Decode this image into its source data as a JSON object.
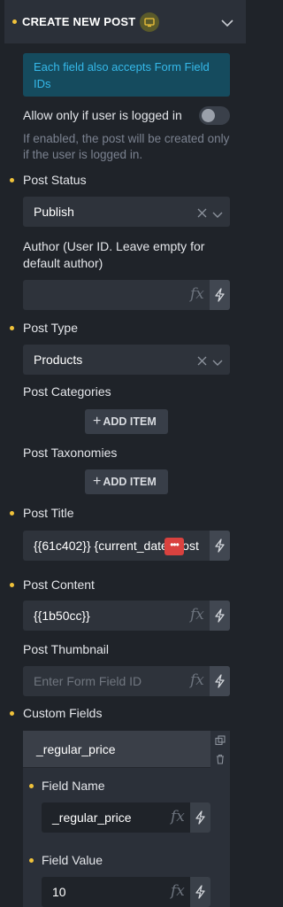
{
  "header": {
    "title": "CREATE NEW POST",
    "badge_icon": "screen-icon",
    "collapse_icon": "chevron-down-icon"
  },
  "info": {
    "text": "Each field also accepts Form Field IDs"
  },
  "logged_in": {
    "label": "Allow only if user is logged in",
    "enabled": false,
    "help": "If enabled, the post will be created only if the user is logged in."
  },
  "post_status": {
    "label": "Post Status",
    "value": "Publish"
  },
  "author": {
    "label": "Author (User ID. Leave empty for default author)",
    "value": ""
  },
  "post_type": {
    "label": "Post Type",
    "value": "Products"
  },
  "post_categories": {
    "label": "Post Categories",
    "add_label": "ADD ITEM"
  },
  "post_taxonomies": {
    "label": "Post Taxonomies",
    "add_label": "ADD ITEM"
  },
  "post_title": {
    "label": "Post Title",
    "value": "{{61c402}} {current_date} post"
  },
  "post_content": {
    "label": "Post Content",
    "value": "{{1b50cc}}"
  },
  "post_thumbnail": {
    "label": "Post Thumbnail",
    "placeholder": "Enter Form Field ID"
  },
  "custom_fields": {
    "label": "Custom Fields",
    "item_title": "_regular_price",
    "field_name_label": "Field Name",
    "field_name_value": "_regular_price",
    "field_value_label": "Field Value",
    "field_value_value": "10"
  },
  "colors": {
    "accent_dot": "#f0c23a",
    "info_bg": "#154b5e",
    "info_text": "#35b9ea",
    "error": "#d9423f"
  }
}
